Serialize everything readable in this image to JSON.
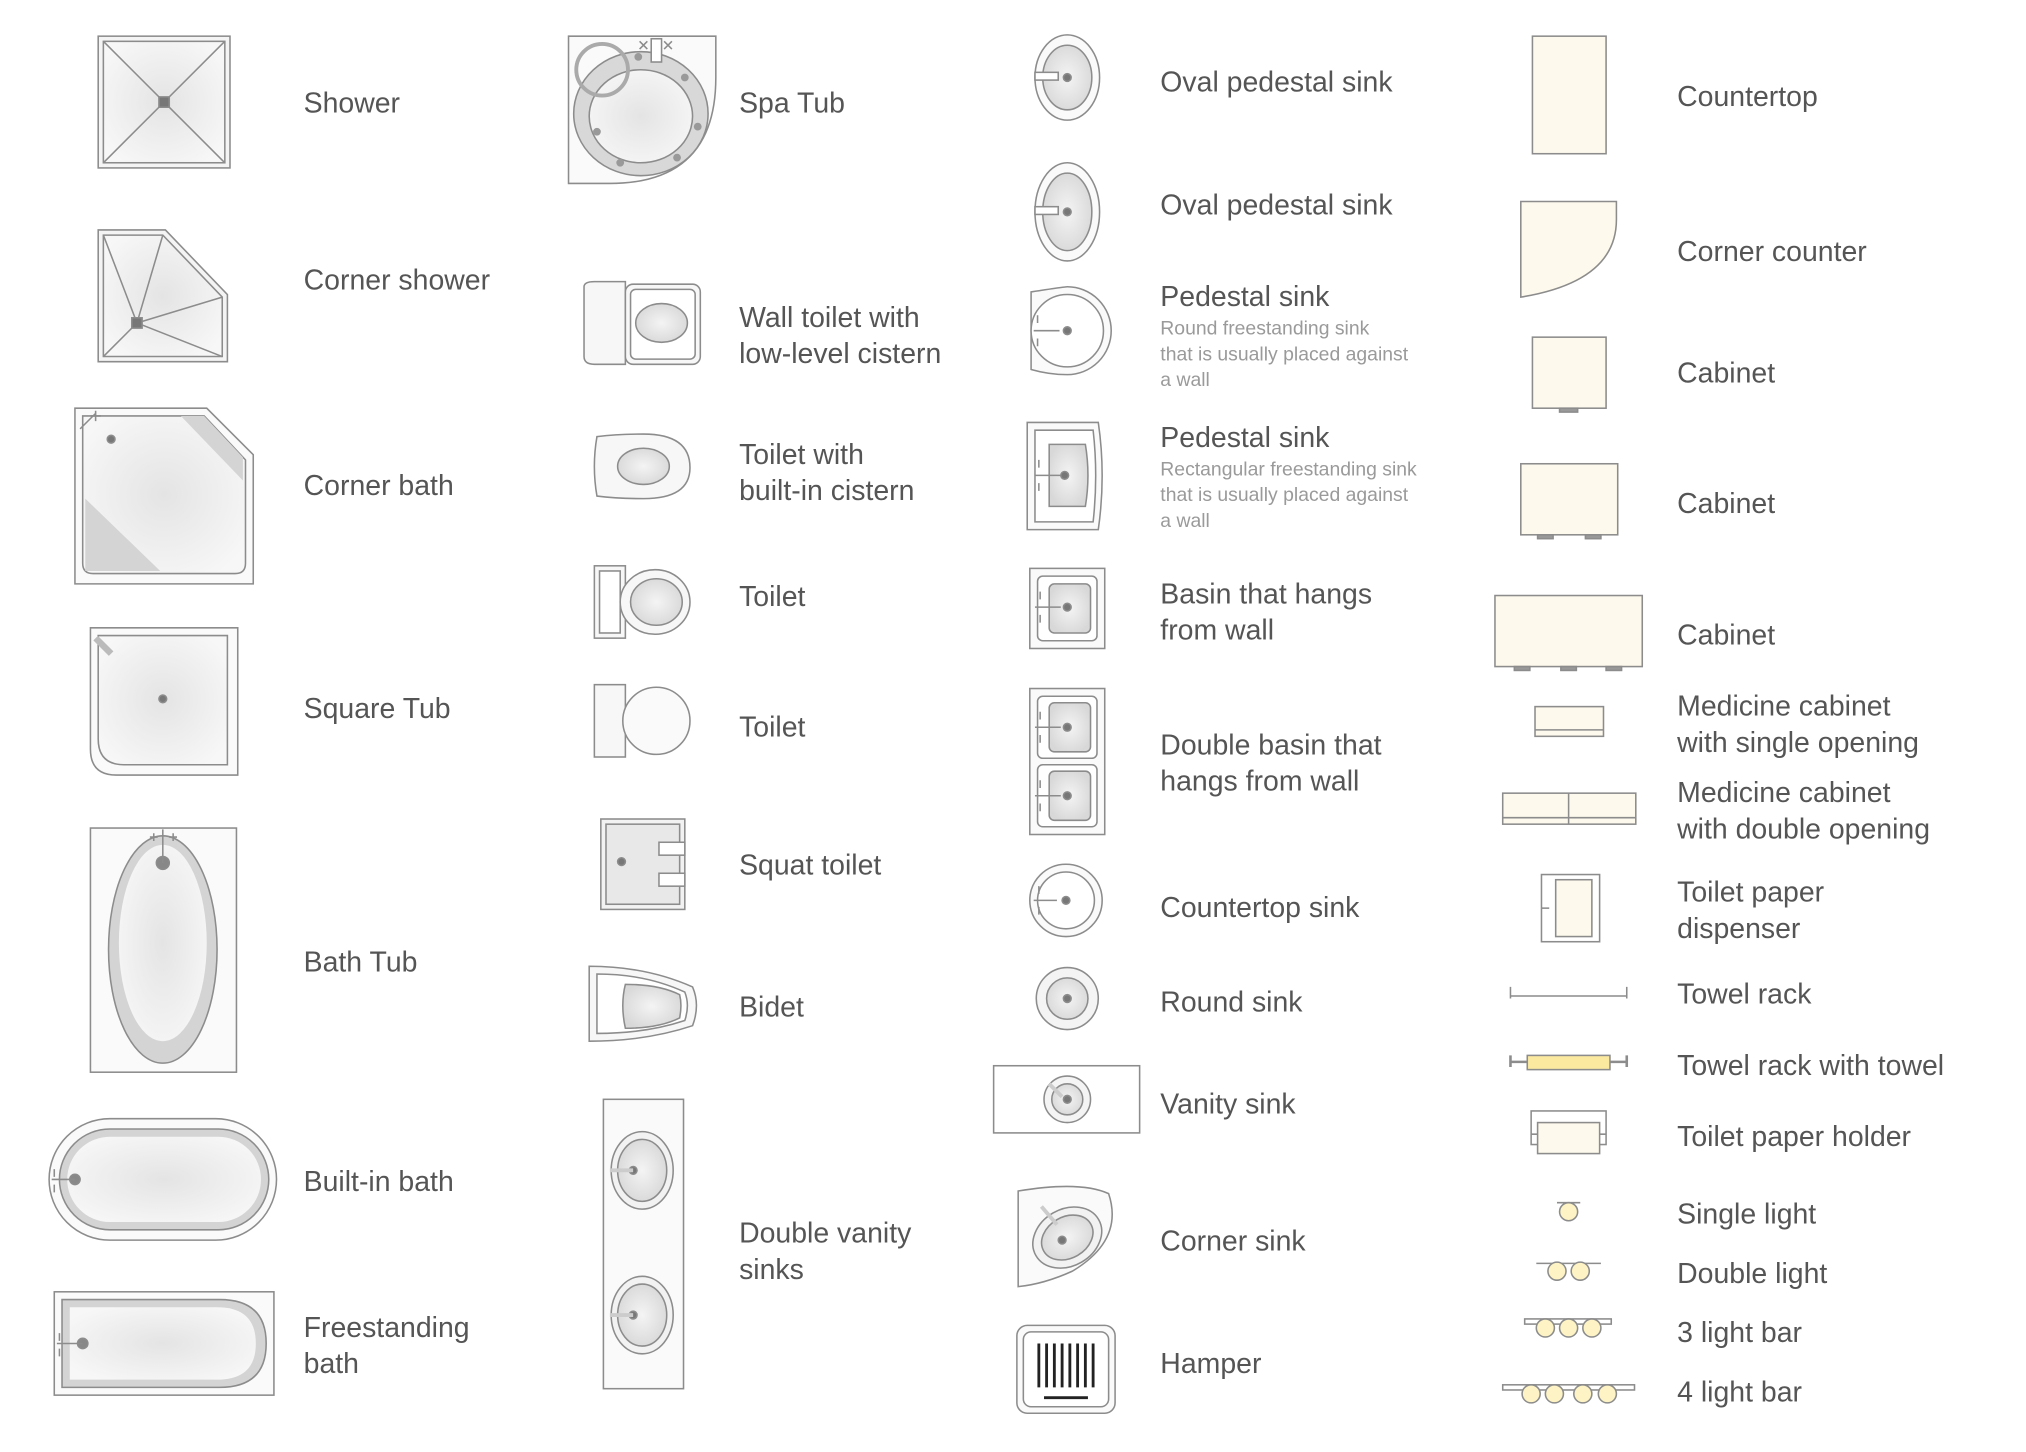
{
  "colors": {
    "stroke": "#8c8c8c",
    "fixture_fill": "#ececec",
    "fixture_shade": "#d4d4d4",
    "cabinet_fill": "#fdf9ec",
    "light_fill": "#fdf3c4",
    "towel_fill": "#fbe9a0",
    "label": "#555555",
    "description": "#9a9a9a"
  },
  "col1": [
    "Shower",
    "Corner shower",
    "Corner bath",
    "Square Tub",
    "Bath Tub",
    "Built-in bath",
    "Freestanding\nbath"
  ],
  "col2": [
    "Spa Tub",
    "Wall toilet with\nlow-level cistern",
    "Toilet with\nbuilt-in cistern",
    "Toilet",
    "Toilet",
    "Squat toilet",
    "Bidet",
    "Double vanity\nsinks"
  ],
  "col3": [
    {
      "label": "Oval pedestal sink"
    },
    {
      "label": "Oval pedestal sink"
    },
    {
      "label": "Pedestal sink",
      "desc": "Round freestanding sink\nthat is usually placed against\na wall"
    },
    {
      "label": "Pedestal sink",
      "desc": "Rectangular freestanding sink\nthat is usually placed against\na wall"
    },
    {
      "label": "Basin that hangs\nfrom wall"
    },
    {
      "label": "Double basin that\nhangs from wall"
    },
    {
      "label": "Countertop sink"
    },
    {
      "label": "Round sink"
    },
    {
      "label": "Vanity sink"
    },
    {
      "label": "Corner sink"
    },
    {
      "label": "Hamper"
    }
  ],
  "col4": [
    "Countertop",
    "Corner counter",
    "Cabinet",
    "Cabinet",
    "Cabinet",
    "Medicine cabinet\nwith single opening",
    "Medicine cabinet\nwith double opening",
    "Toilet paper\ndispenser",
    "Towel rack",
    "Towel rack with towel",
    "Toilet paper holder",
    "Single light",
    "Double light",
    "3 light bar",
    "4 light bar"
  ]
}
